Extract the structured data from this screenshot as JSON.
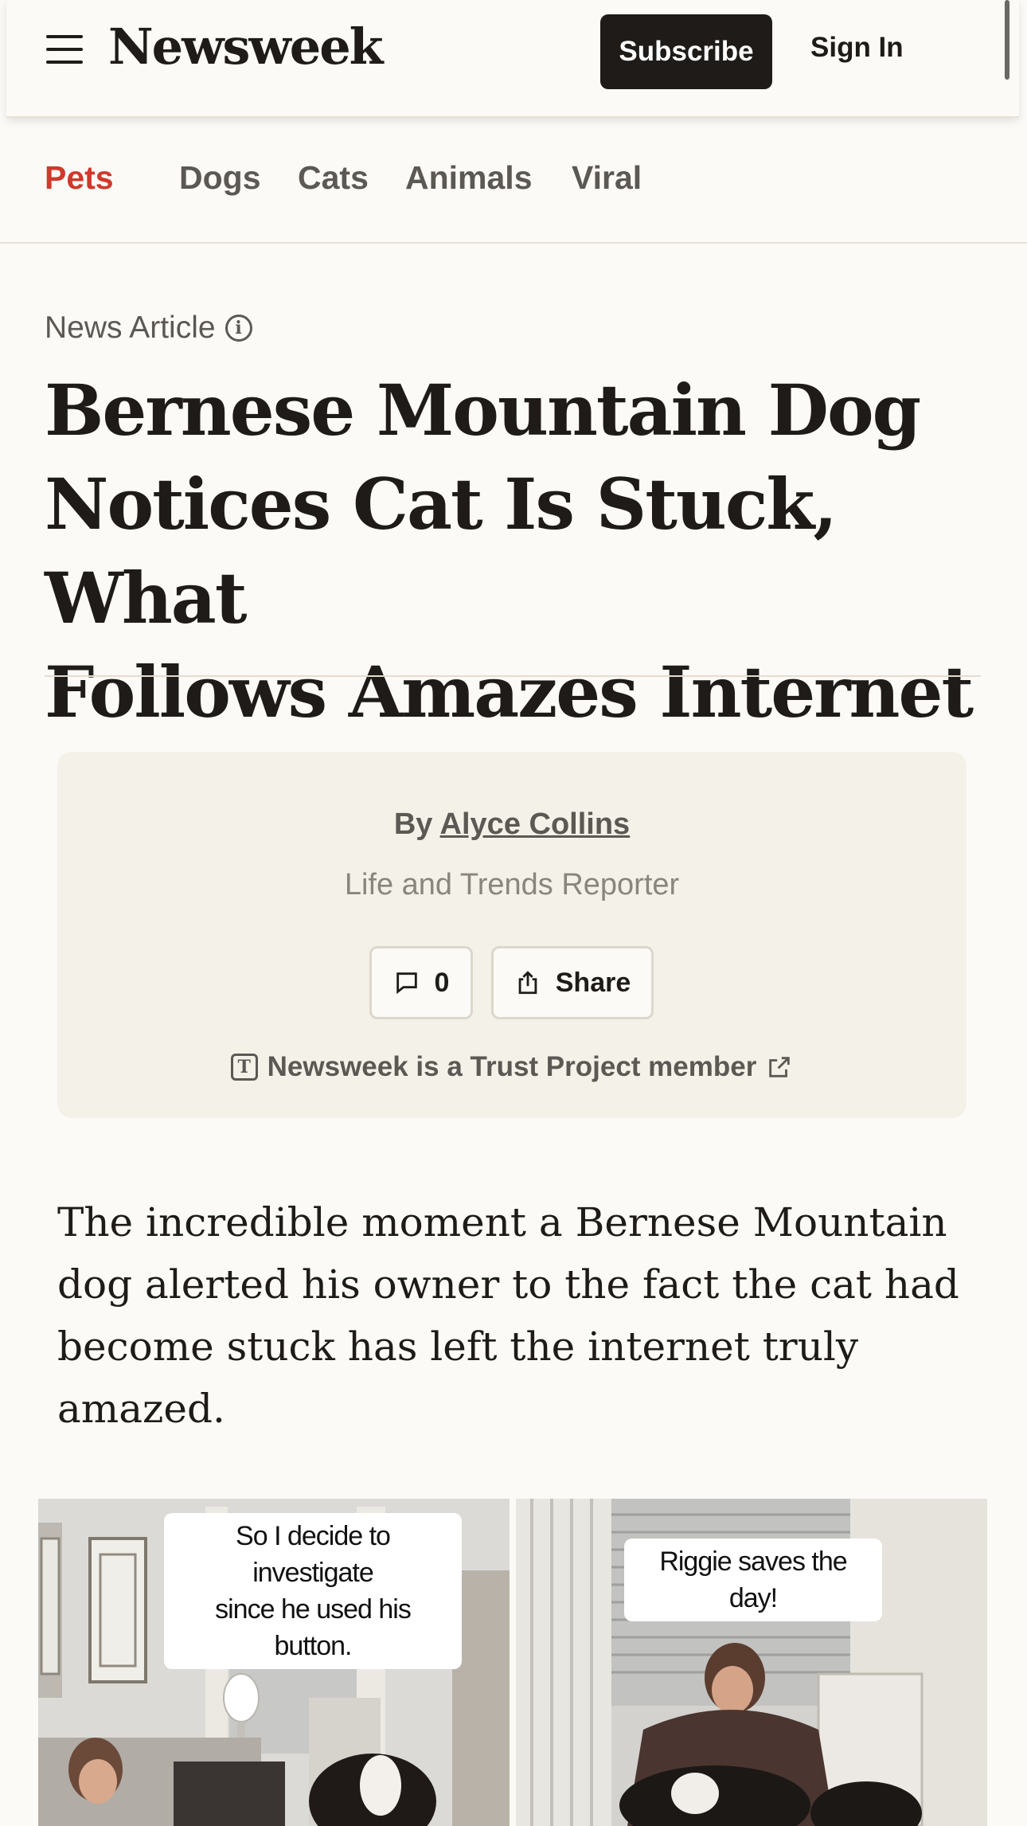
{
  "header": {
    "logo": "Newsweek",
    "subscribe_label": "Subscribe",
    "signin_label": "Sign In"
  },
  "section_nav": {
    "items": [
      "Pets",
      "Dogs",
      "Cats",
      "Animals",
      "Viral"
    ],
    "active": "Pets",
    "accent_color": "#d0392b"
  },
  "article": {
    "kicker": "News Article",
    "headline_lines": [
      "Bernese Mountain Dog",
      "Notices Cat Is Stuck, What",
      "Follows Amazes Internet"
    ],
    "byline_prefix": "By",
    "author": "Alyce Collins",
    "author_role": "Life and Trends Reporter",
    "comment_count": "0",
    "share_label": "Share",
    "trust_text": "Newsweek is a Trust Project member",
    "lede": "The incredible moment a Bernese Mountain dog alerted his owner to the fact the cat had become stuck has left the internet truly amazed."
  },
  "images": {
    "left_caption_lines": [
      "So I decide to investigate",
      "since he used his button."
    ],
    "right_caption": "Riggie saves the day!"
  }
}
